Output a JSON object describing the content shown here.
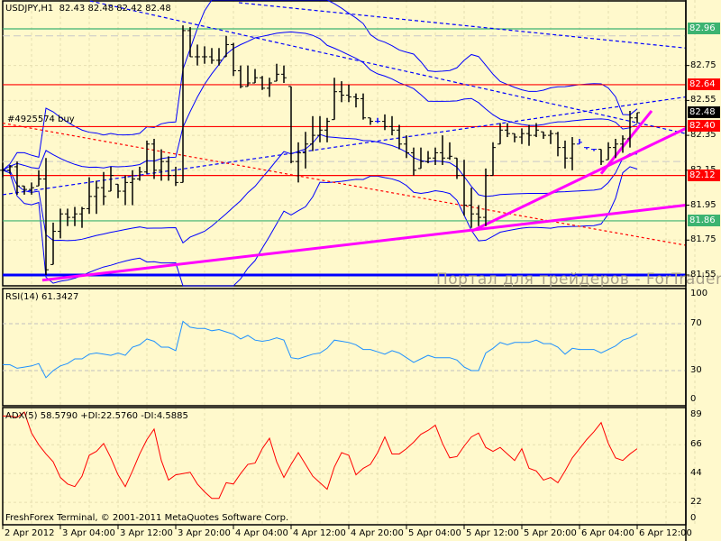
{
  "header": {
    "symbol": "USDJPY,H1",
    "ohlc": "82.43 82.48 82.42 82.48",
    "order_label": "#4925574 buy"
  },
  "watermark": "Портал для трейдеров - ForTrader.ru",
  "footer": "FreshForex Terminal, © 2001-2011 MetaQuotes Software Corp.",
  "colors": {
    "background": "#fff9cc",
    "bars": "#000000",
    "bands": "#0000ff",
    "level_red": "#ff0000",
    "level_green": "#3cb371",
    "trend": "#ff00ff",
    "rsi": "#1e90ff",
    "adx": "#ff0000"
  },
  "chart_data": [
    {
      "type": "bar",
      "title": "USDJPY,H1",
      "price_axis": {
        "min": 81.55,
        "max": 82.96,
        "ticks": [
          "82.75",
          "82.55",
          "82.35",
          "82.15",
          "81.95",
          "81.75",
          "81.55"
        ]
      },
      "time_labels": [
        {
          "bar": 0,
          "label": "2 Apr 2012"
        },
        {
          "bar": 8,
          "label": "3 Apr 04:00"
        },
        {
          "bar": 16,
          "label": "3 Apr 12:00"
        },
        {
          "bar": 24,
          "label": "3 Apr 20:00"
        },
        {
          "bar": 32,
          "label": "4 Apr 04:00"
        },
        {
          "bar": 40,
          "label": "4 Apr 12:00"
        },
        {
          "bar": 48,
          "label": "4 Apr 20:00"
        },
        {
          "bar": 56,
          "label": "5 Apr 04:00"
        },
        {
          "bar": 64,
          "label": "5 Apr 12:00"
        },
        {
          "bar": 72,
          "label": "5 Apr 20:00"
        },
        {
          "bar": 80,
          "label": "6 Apr 04:00"
        },
        {
          "bar": 88,
          "label": "6 Apr 12:00"
        }
      ],
      "bars_hlc": [
        [
          82.19,
          82.11,
          82.15
        ],
        [
          82.18,
          82.13,
          82.17
        ],
        [
          82.2,
          82.01,
          82.06
        ],
        [
          82.06,
          82.01,
          82.04
        ],
        [
          82.08,
          82.01,
          82.05
        ],
        [
          82.15,
          82.06,
          82.1
        ],
        [
          82.22,
          81.55,
          81.58
        ],
        [
          81.85,
          81.61,
          81.8
        ],
        [
          81.93,
          81.76,
          81.9
        ],
        [
          81.93,
          81.83,
          81.88
        ],
        [
          81.94,
          81.83,
          81.9
        ],
        [
          81.94,
          81.82,
          81.93
        ],
        [
          82.11,
          81.9,
          82.0
        ],
        [
          82.09,
          81.9,
          82.05
        ],
        [
          82.14,
          81.95,
          82.0
        ],
        [
          82.17,
          82.03,
          82.12
        ],
        [
          82.07,
          81.99,
          82.03
        ],
        [
          82.12,
          81.95,
          82.08
        ],
        [
          82.15,
          81.95,
          82.1
        ],
        [
          82.17,
          82.09,
          82.14
        ],
        [
          82.32,
          82.13,
          82.3
        ],
        [
          82.33,
          82.1,
          82.15
        ],
        [
          82.27,
          82.09,
          82.2
        ],
        [
          82.23,
          82.09,
          82.12
        ],
        [
          82.17,
          82.06,
          82.08
        ],
        [
          82.98,
          82.08,
          82.95
        ],
        [
          82.97,
          82.8,
          82.8
        ],
        [
          82.87,
          82.75,
          82.8
        ],
        [
          82.86,
          82.76,
          82.8
        ],
        [
          82.85,
          82.76,
          82.78
        ],
        [
          82.85,
          82.75,
          82.78
        ],
        [
          82.92,
          82.8,
          82.87
        ],
        [
          82.88,
          82.69,
          82.72
        ],
        [
          82.75,
          82.62,
          82.63
        ],
        [
          82.75,
          82.63,
          82.65
        ],
        [
          82.73,
          82.65,
          82.68
        ],
        [
          82.69,
          82.61,
          82.62
        ],
        [
          82.68,
          82.57,
          82.65
        ],
        [
          82.76,
          82.66,
          82.7
        ],
        [
          82.75,
          82.65,
          82.68
        ],
        [
          82.63,
          82.19,
          82.2
        ],
        [
          82.31,
          82.08,
          82.25
        ],
        [
          82.37,
          82.16,
          82.3
        ],
        [
          82.46,
          82.26,
          82.35
        ],
        [
          82.46,
          82.31,
          82.38
        ],
        [
          82.45,
          82.31,
          82.43
        ],
        [
          82.68,
          82.44,
          82.6
        ],
        [
          82.66,
          82.54,
          82.58
        ],
        [
          82.64,
          82.54,
          82.57
        ],
        [
          82.59,
          82.51,
          82.56
        ],
        [
          82.59,
          82.44,
          82.45
        ],
        [
          82.45,
          82.41,
          82.43
        ],
        [
          82.45,
          82.42,
          82.43
        ],
        [
          82.47,
          82.38,
          82.4
        ],
        [
          82.46,
          82.35,
          82.38
        ],
        [
          82.41,
          82.27,
          82.3
        ],
        [
          82.35,
          82.22,
          82.25
        ],
        [
          82.28,
          82.12,
          82.15
        ],
        [
          82.28,
          82.16,
          82.2
        ],
        [
          82.26,
          82.19,
          82.22
        ],
        [
          82.28,
          82.18,
          82.25
        ],
        [
          82.35,
          82.18,
          82.22
        ],
        [
          82.31,
          82.21,
          82.23
        ],
        [
          82.22,
          82.1,
          82.12
        ],
        [
          82.21,
          81.89,
          81.95
        ],
        [
          82.05,
          81.82,
          81.9
        ],
        [
          81.95,
          81.83,
          81.88
        ],
        [
          82.16,
          81.83,
          82.12
        ],
        [
          82.31,
          82.12,
          82.28
        ],
        [
          82.42,
          82.3,
          82.38
        ],
        [
          82.42,
          82.34,
          82.36
        ],
        [
          82.36,
          82.31,
          82.34
        ],
        [
          82.39,
          82.3,
          82.36
        ],
        [
          82.41,
          82.29,
          82.35
        ],
        [
          82.42,
          82.34,
          82.38
        ],
        [
          82.37,
          82.33,
          82.35
        ],
        [
          82.38,
          82.3,
          82.36
        ],
        [
          82.37,
          82.23,
          82.28
        ],
        [
          82.32,
          82.16,
          82.22
        ],
        [
          82.34,
          82.15,
          82.3
        ],
        [
          82.33,
          82.3,
          82.31
        ],
        [
          82.28,
          82.27,
          82.28
        ],
        [
          82.27,
          82.26,
          82.27
        ],
        [
          82.27,
          82.18,
          82.2
        ],
        [
          82.31,
          82.21,
          82.28
        ],
        [
          82.33,
          82.22,
          82.3
        ],
        [
          82.35,
          82.25,
          82.33
        ],
        [
          82.49,
          82.28,
          82.45
        ],
        [
          82.48,
          82.42,
          82.48
        ]
      ],
      "levels": [
        {
          "price": 82.96,
          "label": "82.96",
          "color": "#3cb371"
        },
        {
          "price": 82.64,
          "label": "82.64",
          "color": "#ff0000"
        },
        {
          "price": 82.4,
          "label": "82.40",
          "color": "#ff0000"
        },
        {
          "price": 82.12,
          "label": "82.12",
          "color": "#ff0000"
        },
        {
          "price": 81.86,
          "label": "81.86",
          "color": "#3cb371"
        },
        {
          "price": 81.55,
          "label": "",
          "color": "#0000ff"
        }
      ],
      "current_price": {
        "price": 82.48,
        "label": "82.48"
      },
      "gray_lines": [
        82.92,
        82.2
      ],
      "trendlines": [
        {
          "from": [
            12.1,
            83.12
          ],
          "to": [
            94.75,
            82.36
          ],
          "style": "blue-dashed"
        },
        {
          "from": [
            32.75,
            83.11
          ],
          "to": [
            94.75,
            82.85
          ],
          "style": "blue-dashed"
        },
        {
          "from": [
            0,
            82.01
          ],
          "to": [
            94.75,
            82.57
          ],
          "style": "blue-dashed"
        },
        {
          "from": [
            0,
            82.42
          ],
          "to": [
            94.75,
            81.72
          ],
          "style": "red-dotted"
        },
        {
          "from": [
            5.5,
            81.52
          ],
          "to": [
            94.75,
            81.95
          ],
          "style": "magenta"
        },
        {
          "from": [
            65,
            81.8
          ],
          "to": [
            94.75,
            82.39
          ],
          "style": "magenta"
        },
        {
          "from": [
            83,
            82.13
          ],
          "to": [
            90,
            82.49
          ],
          "style": "magenta"
        }
      ]
    },
    {
      "type": "line",
      "title": "RSI(14) 61.3427",
      "ylim": [
        0,
        100
      ],
      "ticks": [
        "100",
        "70",
        "30",
        "0"
      ],
      "levels": [
        70,
        30
      ],
      "values": [
        35,
        35,
        32,
        33,
        34,
        36,
        24,
        30,
        34,
        36,
        40,
        40,
        44,
        45,
        44,
        43,
        45,
        43,
        50,
        52,
        57,
        55,
        50,
        50,
        47,
        72,
        67,
        66,
        66,
        64,
        65,
        63,
        61,
        57,
        60,
        56,
        55,
        56,
        58,
        56,
        41,
        40,
        42,
        44,
        45,
        49,
        56,
        55,
        54,
        52,
        48,
        48,
        46,
        44,
        47,
        45,
        41,
        37,
        40,
        43,
        41,
        41,
        41,
        39,
        33,
        30,
        30,
        45,
        49,
        54,
        52,
        54,
        54,
        54,
        56,
        53,
        53,
        50,
        44,
        49,
        48,
        48,
        48,
        45,
        48,
        51,
        56,
        58,
        61.34
      ]
    },
    {
      "type": "line",
      "title": "ADX(5) 58.5790 +DI:22.5760 -DI:4.5885",
      "ylim": [
        0,
        89
      ],
      "ticks": [
        "89",
        "66",
        "44",
        "22",
        "0"
      ],
      "values": [
        88,
        88,
        87,
        91,
        75,
        66,
        59,
        53,
        41,
        36,
        34,
        42,
        58,
        61,
        67,
        56,
        43,
        34,
        46,
        59,
        70,
        78,
        54,
        39,
        43,
        44,
        45,
        36,
        30,
        25,
        25,
        37,
        36,
        44,
        51,
        52,
        63,
        71,
        53,
        41,
        51,
        60,
        51,
        42,
        37,
        32,
        49,
        60,
        58,
        43,
        48,
        51,
        60,
        72,
        59,
        59,
        63,
        68,
        74,
        77,
        81,
        67,
        56,
        57,
        65,
        72,
        75,
        64,
        61,
        64,
        59,
        54,
        63,
        48,
        46,
        39,
        41,
        37,
        46,
        56,
        63,
        70,
        76,
        83,
        67,
        56,
        54,
        59,
        63
      ]
    }
  ]
}
